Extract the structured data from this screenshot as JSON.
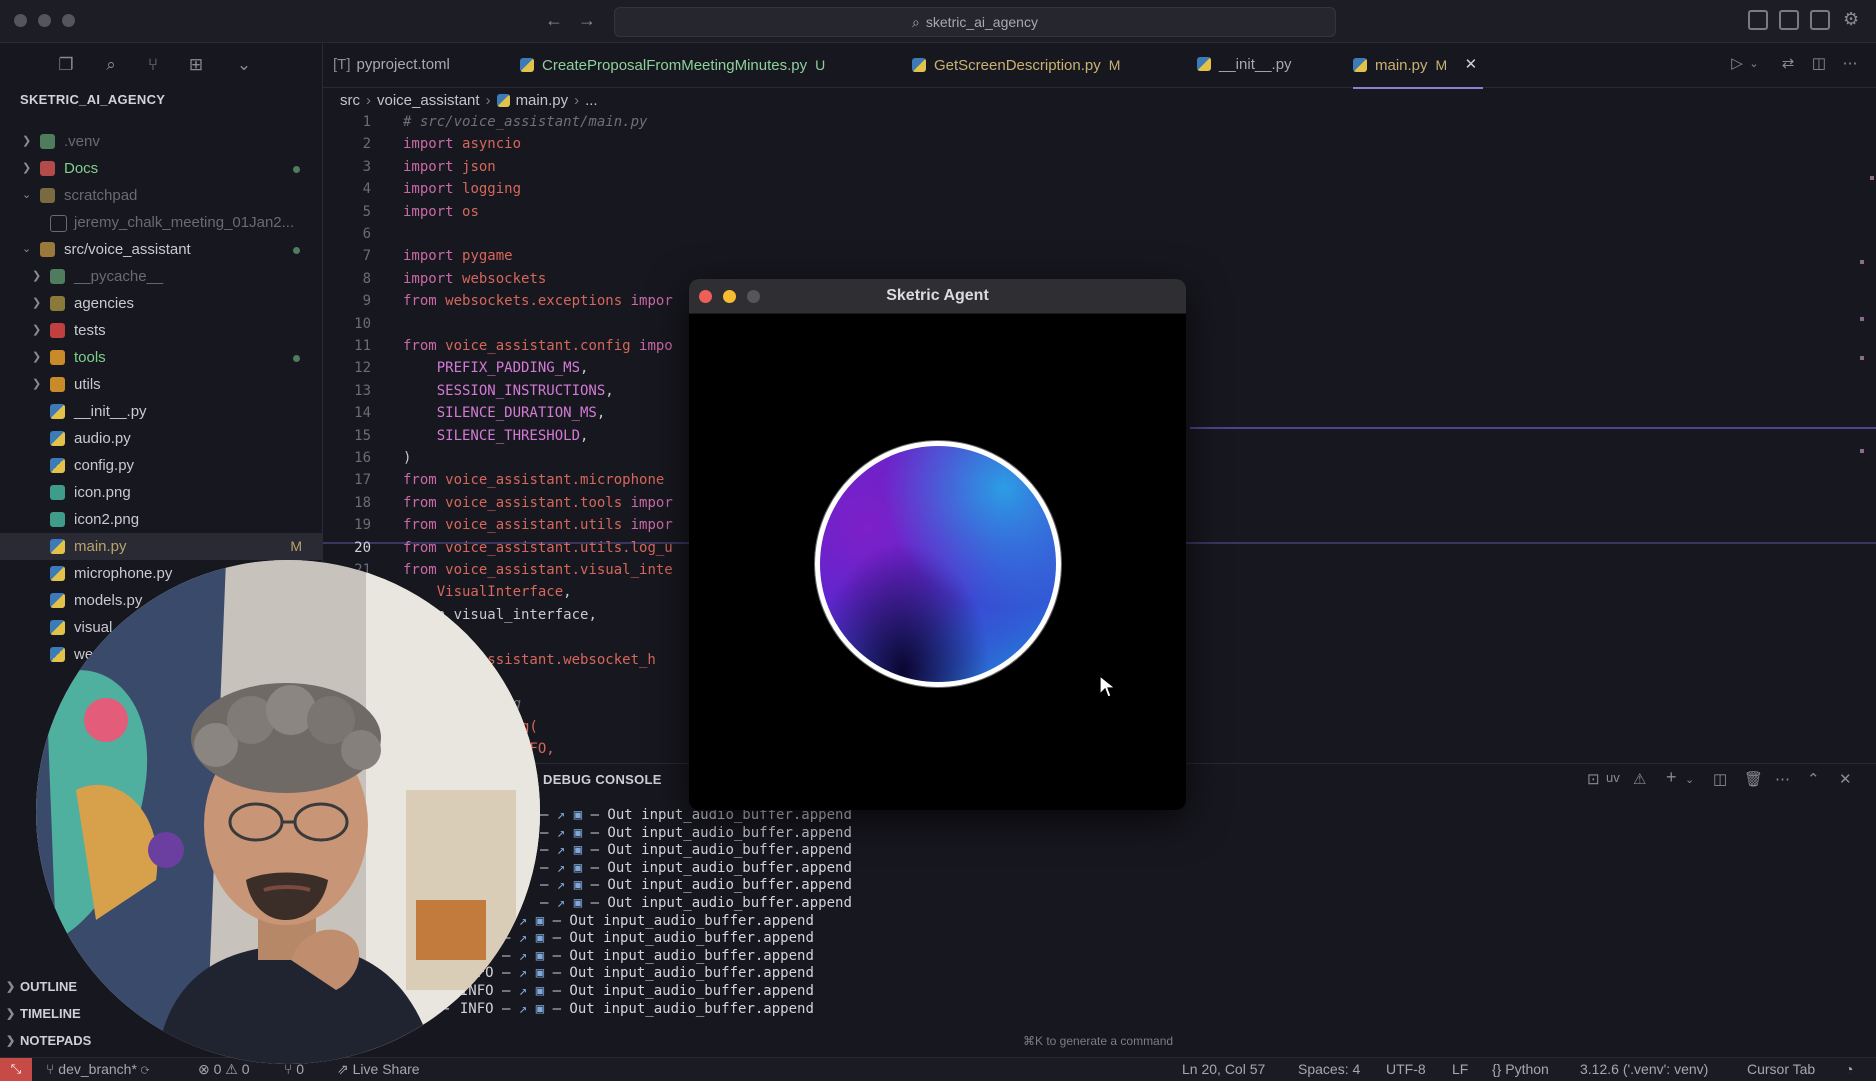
{
  "titlebar": {
    "search": "sketric_ai_agency"
  },
  "explorer": {
    "title": "SKETRIC_AI_AGENCY",
    "items": [
      {
        "label": ".venv",
        "color": "#6a6a76"
      },
      {
        "label": "Docs",
        "color": "#7fd08c"
      },
      {
        "label": "scratchpad",
        "color": "#6a6a76"
      },
      {
        "label": "jeremy_chalk_meeting_01Jan2...",
        "color": "#6a6a76"
      },
      {
        "label": "src/voice_assistant",
        "color": "#c9c9d1"
      },
      {
        "label": "__pycache__",
        "color": "#6a6a76"
      },
      {
        "label": "agencies",
        "color": "#c9c9d1"
      },
      {
        "label": "tests",
        "color": "#c9c9d1"
      },
      {
        "label": "tools",
        "color": "#7fd08c"
      },
      {
        "label": "utils",
        "color": "#c9c9d1"
      },
      {
        "label": "__init__.py",
        "color": "#c9c9d1"
      },
      {
        "label": "audio.py",
        "color": "#c9c9d1"
      },
      {
        "label": "config.py",
        "color": "#c9c9d1"
      },
      {
        "label": "icon.png",
        "color": "#c9c9d1"
      },
      {
        "label": "icon2.png",
        "color": "#c9c9d1"
      },
      {
        "label": "main.py",
        "color": "#b8a36a",
        "badge": "M"
      },
      {
        "label": "microphone.py",
        "color": "#c9c9d1"
      },
      {
        "label": "models.py",
        "color": "#c9c9d1"
      },
      {
        "label": "visual",
        "color": "#c9c9d1"
      },
      {
        "label": "we",
        "color": "#c9c9d1"
      }
    ],
    "sections": [
      "OUTLINE",
      "TIMELINE",
      "NOTEPADS"
    ]
  },
  "tabs": [
    {
      "label": "pyproject.toml",
      "flag": "",
      "color": "#a8a8b3"
    },
    {
      "label": "CreateProposalFromMeetingMinutes.py",
      "flag": "U",
      "color": "#8fd09a"
    },
    {
      "label": "GetScreenDescription.py",
      "flag": "M",
      "color": "#c8b273"
    },
    {
      "label": "__init__.py",
      "flag": "",
      "color": "#a8a8b3"
    },
    {
      "label": "main.py",
      "flag": "M",
      "color": "#c8b273"
    }
  ],
  "breadcrumb": [
    "src",
    "voice_assistant",
    "main.py",
    "..."
  ],
  "editor": {
    "line_numbers": [
      "1",
      "2",
      "3",
      "4",
      "5",
      "6",
      "7",
      "8",
      "9",
      "10",
      "11",
      "12",
      "13",
      "14",
      "15",
      "16",
      "17",
      "18",
      "19",
      "20",
      "21"
    ],
    "current_line": "20",
    "lines": [
      {
        "ln": "1",
        "parts": [
          {
            "t": "# src/voice_assistant/main.py",
            "c": "cmt"
          }
        ]
      },
      {
        "ln": "2",
        "parts": [
          {
            "t": "import ",
            "c": "kw"
          },
          {
            "t": "asyncio",
            "c": "mod-n"
          }
        ]
      },
      {
        "ln": "3",
        "parts": [
          {
            "t": "import ",
            "c": "kw"
          },
          {
            "t": "json",
            "c": "mod-n"
          }
        ]
      },
      {
        "ln": "4",
        "parts": [
          {
            "t": "import ",
            "c": "kw"
          },
          {
            "t": "logging",
            "c": "mod-n"
          }
        ]
      },
      {
        "ln": "5",
        "parts": [
          {
            "t": "import ",
            "c": "kw"
          },
          {
            "t": "os",
            "c": "mod-n"
          }
        ]
      },
      {
        "ln": "6",
        "parts": []
      },
      {
        "ln": "7",
        "parts": [
          {
            "t": "import ",
            "c": "kw"
          },
          {
            "t": "pygame",
            "c": "mod-n"
          }
        ]
      },
      {
        "ln": "8",
        "parts": [
          {
            "t": "import ",
            "c": "kw"
          },
          {
            "t": "websockets",
            "c": "mod-n"
          }
        ]
      },
      {
        "ln": "9",
        "parts": [
          {
            "t": "from ",
            "c": "kw"
          },
          {
            "t": "websockets.exceptions",
            "c": "mod-n"
          },
          {
            "t": " impor",
            "c": "kw"
          }
        ]
      },
      {
        "ln": "10",
        "parts": []
      },
      {
        "ln": "11",
        "parts": [
          {
            "t": "from ",
            "c": "kw"
          },
          {
            "t": "voice_assistant.config",
            "c": "mod-n"
          },
          {
            "t": " impo",
            "c": "kw"
          }
        ]
      },
      {
        "ln": "12",
        "parts": [
          {
            "t": "    PREFIX_PADDING_MS",
            "c": "const"
          },
          {
            "t": ",",
            "c": ""
          }
        ]
      },
      {
        "ln": "13",
        "parts": [
          {
            "t": "    SESSION_INSTRUCTIONS",
            "c": "const"
          },
          {
            "t": ",",
            "c": ""
          }
        ]
      },
      {
        "ln": "14",
        "parts": [
          {
            "t": "    SILENCE_DURATION_MS",
            "c": "const"
          },
          {
            "t": ",",
            "c": ""
          }
        ]
      },
      {
        "ln": "15",
        "parts": [
          {
            "t": "    SILENCE_THRESHOLD",
            "c": "const"
          },
          {
            "t": ",",
            "c": ""
          }
        ]
      },
      {
        "ln": "16",
        "parts": [
          {
            "t": ")",
            "c": ""
          }
        ]
      },
      {
        "ln": "17",
        "parts": [
          {
            "t": "from ",
            "c": "kw"
          },
          {
            "t": "voice_assistant.microphone",
            "c": "mod-n"
          }
        ]
      },
      {
        "ln": "18",
        "parts": [
          {
            "t": "from ",
            "c": "kw"
          },
          {
            "t": "voice_assistant.tools",
            "c": "mod-n"
          },
          {
            "t": " impor",
            "c": "kw"
          }
        ]
      },
      {
        "ln": "19",
        "parts": [
          {
            "t": "from ",
            "c": "kw"
          },
          {
            "t": "voice_assistant.utils",
            "c": "mod-n"
          },
          {
            "t": " impor",
            "c": "kw"
          }
        ]
      },
      {
        "ln": "20",
        "parts": [
          {
            "t": "from ",
            "c": "kw"
          },
          {
            "t": "voice_assistant.utils.log_u",
            "c": "mod-n"
          }
        ]
      },
      {
        "ln": "21",
        "parts": [
          {
            "t": "from ",
            "c": "kw"
          },
          {
            "t": "voice_assistant.visual_inte",
            "c": "mod-n"
          }
        ]
      },
      {
        "ln": "22",
        "parts": [
          {
            "t": "    VisualInterface",
            "c": "mod-n"
          },
          {
            "t": ",",
            "c": ""
          }
        ]
      },
      {
        "ln": "23",
        "parts": [
          {
            "t": "   un_visual_interface",
            "c": ""
          },
          {
            "t": ",",
            "c": ""
          }
        ]
      },
      {
        "ln": "24",
        "parts": []
      },
      {
        "ln": "25",
        "parts": [
          {
            "t": "        _assistant.websocket_h",
            "c": "mod-n"
          }
        ]
      },
      {
        "ln": "26",
        "parts": []
      },
      {
        "ln": "27",
        "parts": [
          {
            "t": "          ging",
            "c": "cmt"
          }
        ]
      },
      {
        "ln": "28",
        "parts": [
          {
            "t": "         Config(",
            "c": "mod-n"
          }
        ]
      },
      {
        "ln": "29",
        "parts": [
          {
            "t": "         ing.INFO,",
            "c": "mod-n"
          }
        ]
      }
    ]
  },
  "panel": {
    "tab": "DEBUG CONSOLE",
    "actions": [
      "uv"
    ],
    "log_prefix": "INFO",
    "log_lines": [
      "Out input_audio_buffer.append",
      "Out input_audio_buffer.append",
      "Out input_audio_buffer.append",
      "Out input_audio_buffer.append",
      "Out input_audio_buffer.append",
      "Out input_audio_buffer.append",
      "Out input_audio_buffer.append",
      "Out input_audio_buffer.append",
      "Out input_audio_buffer.append",
      "Out input_audio_buffer.append",
      "Out input_audio_buffer.append",
      "Out input_audio_buffer.append"
    ],
    "hint": "⌘K to generate a command"
  },
  "statusbar": {
    "branch": "dev_branch*",
    "problems": "⊗ 0 ⚠ 0",
    "ports": "⑂ 0",
    "live_share": "Live Share",
    "position": "Ln 20, Col 57",
    "spaces": "Spaces: 4",
    "encoding": "UTF-8",
    "eol": "LF",
    "language": "Python",
    "interpreter": "3.12.6 ('.venv': venv)",
    "cursor_tab": "Cursor Tab"
  },
  "agent_window": {
    "title": "Sketric Agent"
  },
  "colors": {
    "accent": "#8e7fd6",
    "remote": "#c64a46",
    "modified": "#c8b273",
    "untracked": "#8fd09a"
  }
}
